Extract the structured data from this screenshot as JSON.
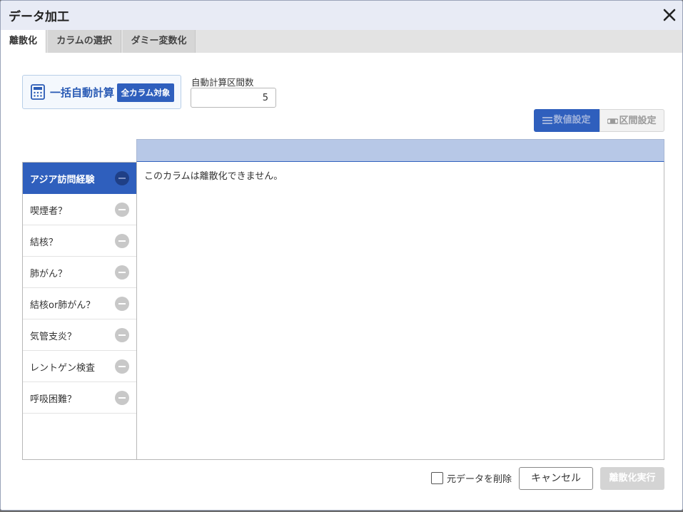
{
  "dialog": {
    "title": "データ加工"
  },
  "tabs": [
    {
      "label": "離散化",
      "active": true
    },
    {
      "label": "カラムの選択",
      "active": false
    },
    {
      "label": "ダミー変数化",
      "active": false
    }
  ],
  "auto_calc": {
    "label": "一括自動計算",
    "all_columns_button": "全カラム対象",
    "icon": "calculator-icon"
  },
  "interval_count": {
    "label": "自動計算区間数",
    "value": "5"
  },
  "mode_toggle": {
    "numeric_label": "数値設定",
    "interval_label": "区間設定",
    "selected": "numeric"
  },
  "columns": [
    {
      "label": "アジア訪問経験",
      "selected": true
    },
    {
      "label": "喫煙者？",
      "selected": false
    },
    {
      "label": "結核？",
      "selected": false
    },
    {
      "label": "肺がん？",
      "selected": false
    },
    {
      "label": "結核or肺がん？",
      "selected": false
    },
    {
      "label": "気管支炎？",
      "selected": false
    },
    {
      "label": "レントゲン検査",
      "selected": false
    },
    {
      "label": "呼吸困難？",
      "selected": false
    }
  ],
  "content": {
    "message": "このカラムは離散化できません。"
  },
  "footer": {
    "delete_original_label": "元データを削除",
    "delete_original_checked": false,
    "cancel_label": "キャンセル",
    "execute_label": "離散化実行"
  },
  "colors": {
    "accent": "#2f5fbd",
    "header_band": "#b7c8e7",
    "titlebar": "#e8ebf5",
    "disabled": "#d4d4d4"
  }
}
